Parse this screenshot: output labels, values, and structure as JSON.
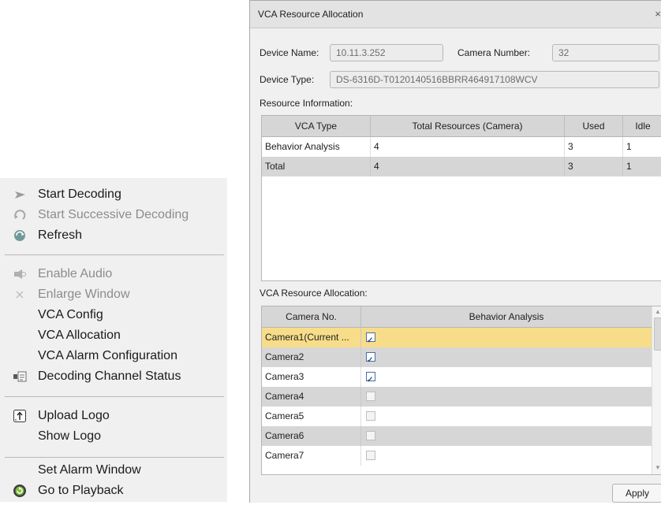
{
  "context_menu": {
    "items": [
      {
        "label": "Start Decoding",
        "icon": "play-icon",
        "enabled": true
      },
      {
        "label": "Start Successive Decoding",
        "icon": "successive-decoding-icon",
        "enabled": false
      },
      {
        "label": "Refresh",
        "icon": "refresh-icon",
        "enabled": true
      },
      {
        "label": "Enable Audio",
        "icon": "audio-icon",
        "enabled": false
      },
      {
        "label": "Enlarge Window",
        "icon": "enlarge-icon",
        "enabled": false
      },
      {
        "label": "VCA Config",
        "icon": "",
        "enabled": true
      },
      {
        "label": "VCA Allocation",
        "icon": "",
        "enabled": true
      },
      {
        "label": "VCA Alarm Configuration",
        "icon": "",
        "enabled": true
      },
      {
        "label": "Decoding Channel Status",
        "icon": "channel-status-icon",
        "enabled": true
      },
      {
        "label": "Upload Logo",
        "icon": "upload-icon",
        "enabled": true
      },
      {
        "label": "Show Logo",
        "icon": "",
        "enabled": true
      },
      {
        "label": "Set Alarm Window",
        "icon": "",
        "enabled": true
      },
      {
        "label": "Go to Playback",
        "icon": "playback-icon",
        "enabled": true
      }
    ]
  },
  "dialog": {
    "title": "VCA Resource Allocation",
    "close_glyph": "×",
    "device_name_label": "Device Name:",
    "device_name_value": "10.11.3.252",
    "camera_number_label": "Camera Number:",
    "camera_number_value": "32",
    "device_type_label": "Device Type:",
    "device_type_value": "DS-6316D-T0120140516BBRR464917108WCV",
    "resource_section_label": "Resource Information:",
    "resource_table": {
      "columns": [
        "VCA Type",
        "Total Resources (Camera)",
        "Used",
        "Idle"
      ],
      "rows": [
        [
          "Behavior Analysis",
          "4",
          "3",
          "1"
        ],
        [
          "Total",
          "4",
          "3",
          "1"
        ]
      ]
    },
    "allocation_section_label": "VCA Resource Allocation:",
    "allocation_table": {
      "columns": [
        "Camera No.",
        "Behavior Analysis"
      ],
      "rows": [
        {
          "camera": "Camera1(Current ...",
          "checked": true,
          "enabled": true,
          "selected": true
        },
        {
          "camera": "Camera2",
          "checked": true,
          "enabled": true,
          "selected": false
        },
        {
          "camera": "Camera3",
          "checked": true,
          "enabled": true,
          "selected": false
        },
        {
          "camera": "Camera4",
          "checked": false,
          "enabled": false,
          "selected": false
        },
        {
          "camera": "Camera5",
          "checked": false,
          "enabled": false,
          "selected": false
        },
        {
          "camera": "Camera6",
          "checked": false,
          "enabled": false,
          "selected": false
        },
        {
          "camera": "Camera7",
          "checked": false,
          "enabled": false,
          "selected": false
        }
      ]
    },
    "apply_label": "Apply"
  },
  "colors": {
    "menu_bg": "#f0f0f0",
    "dialog_bg": "#f0f0f0",
    "selected_row": "#f7dc8a",
    "striped_row": "#d6d6d6",
    "disabled_text": "#8c8c8c"
  }
}
